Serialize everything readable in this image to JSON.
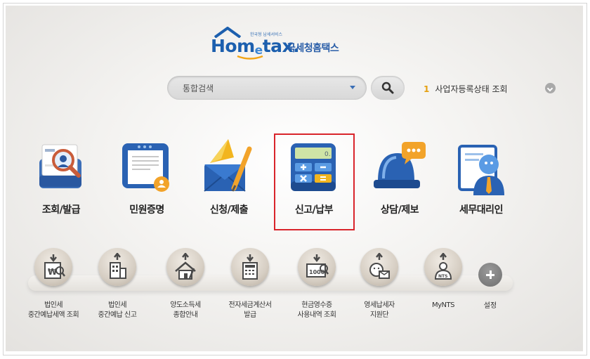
{
  "logo": {
    "brand": "Hometax.",
    "tagline": "한국형 납세서비스",
    "korean": "국세청홈택스"
  },
  "search": {
    "placeholder": "통합검색",
    "button_icon": "search-icon"
  },
  "ranking": {
    "number": "1",
    "text": "사업자등록상태 조회"
  },
  "main_menu": [
    {
      "label": "조회/발급",
      "icon": "inquiry-magnifier-icon"
    },
    {
      "label": "민원증명",
      "icon": "certificate-document-icon"
    },
    {
      "label": "신청/제출",
      "icon": "envelope-pen-icon"
    },
    {
      "label": "신고/납부",
      "icon": "calculator-icon",
      "highlighted": true
    },
    {
      "label": "상담/제보",
      "icon": "siren-chat-icon"
    },
    {
      "label": "세무대리인",
      "icon": "tax-agent-person-icon"
    }
  ],
  "quick_menu": [
    {
      "label": "법인세\n중간예납세액 조회",
      "icon": "won-document-icon"
    },
    {
      "label": "법인세\n중간예납 신고",
      "icon": "building-icon"
    },
    {
      "label": "양도소득세\n종합안내",
      "icon": "house-icon"
    },
    {
      "label": "전자세금계산서\n발급",
      "icon": "invoice-icon"
    },
    {
      "label": "현금영수증\n사용내역 조회",
      "icon": "receipt-search-icon"
    },
    {
      "label": "영세납세자\n지원단",
      "icon": "people-mail-icon"
    },
    {
      "label": "MyNTS",
      "icon": "nts-person-icon",
      "badge": "NTS"
    }
  ],
  "settings": {
    "label": "설정",
    "icon": "plus-icon"
  },
  "colors": {
    "brand_blue": "#1c5fae",
    "highlight_red": "#d9242b",
    "rank_number": "#e5a010"
  }
}
